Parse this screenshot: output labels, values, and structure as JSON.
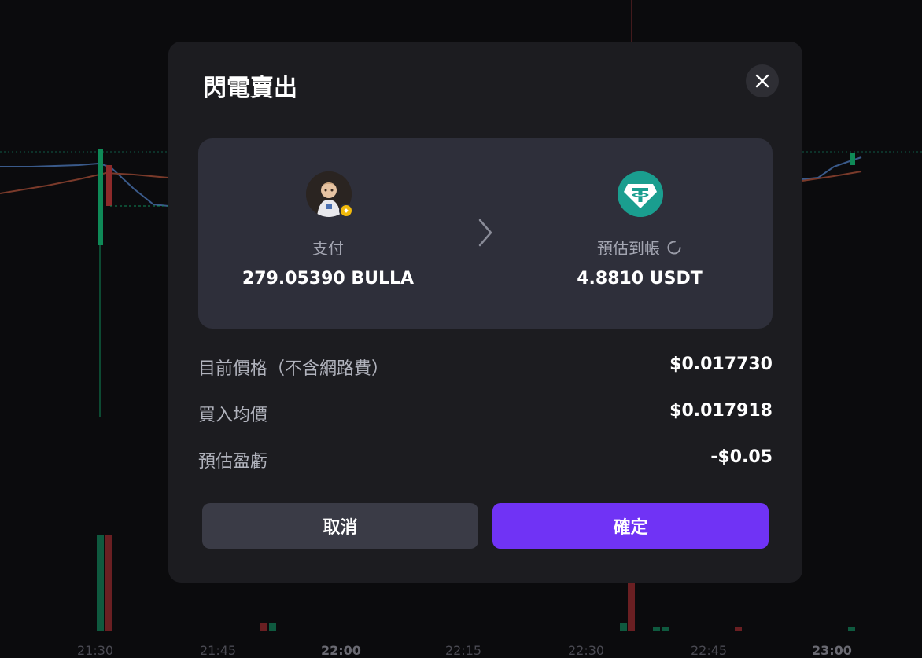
{
  "modal": {
    "title": "閃電賣出",
    "close_icon": "close-icon"
  },
  "swap": {
    "pay_label": "支付",
    "pay_amount": "279.05390 BULLA",
    "pay_token_icon": "bulla-token-avatar",
    "estimate_label": "預估到帳",
    "estimate_amount": "4.8810 USDT",
    "estimate_token_icon": "usdt-icon",
    "arrow_icon": "chevron-right-icon",
    "loading_icon": "spinner-icon"
  },
  "details": [
    {
      "label": "目前價格（不含網路費）",
      "value": "$0.017730"
    },
    {
      "label": "買入均價",
      "value": "$0.017918"
    },
    {
      "label": "預估盈虧",
      "value": "-$0.05"
    }
  ],
  "buttons": {
    "cancel": "取消",
    "confirm": "確定"
  },
  "chart_axis": {
    "times": [
      "21:30",
      "21:45",
      "22:00",
      "22:15",
      "22:30",
      "22:45",
      "23:00"
    ]
  },
  "colors": {
    "accent": "#7033f5",
    "usdt": "#1a9e8f",
    "up": "#0f8a57",
    "down": "#8e2a2a",
    "badge": "#f0b90b"
  }
}
